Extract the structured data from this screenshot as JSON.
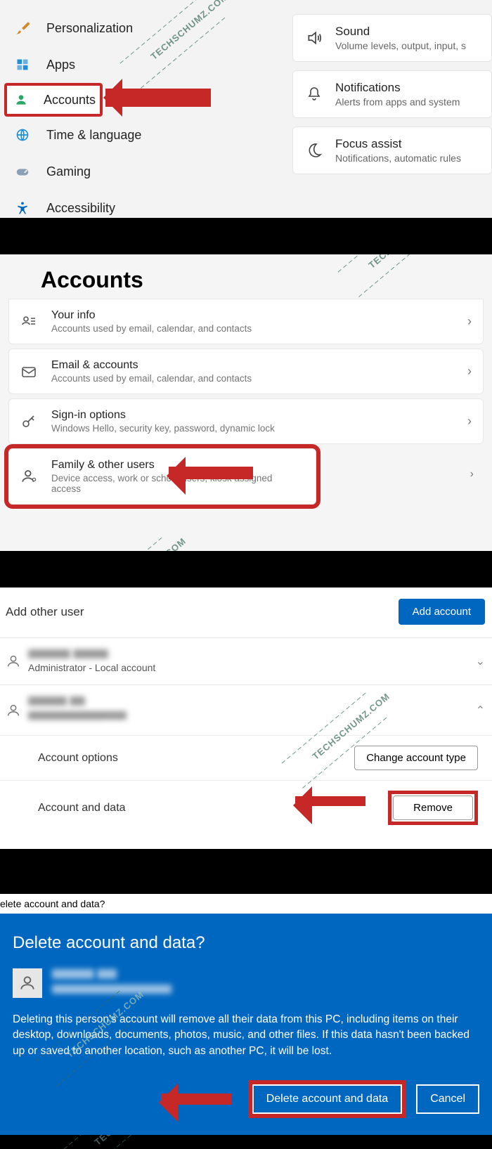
{
  "panel1": {
    "sidebar": [
      {
        "icon": "brush",
        "label": "Personalization",
        "color": "#d28a2b"
      },
      {
        "icon": "apps",
        "label": "Apps",
        "color": "#1f8fd6"
      },
      {
        "icon": "person",
        "label": "Accounts",
        "color": "#2aa866",
        "highlight": true
      },
      {
        "icon": "globe",
        "label": "Time & language",
        "color": "#1f8fd6"
      },
      {
        "icon": "game",
        "label": "Gaming",
        "color": "#8aa0b4"
      },
      {
        "icon": "access",
        "label": "Accessibility",
        "color": "#0067c0"
      }
    ],
    "cards": [
      {
        "icon": "sound",
        "title": "Sound",
        "sub": "Volume levels, output, input, s"
      },
      {
        "icon": "bell",
        "title": "Notifications",
        "sub": "Alerts from apps and system"
      },
      {
        "icon": "moon",
        "title": "Focus assist",
        "sub": "Notifications, automatic rules"
      }
    ]
  },
  "panel2": {
    "heading": "Accounts",
    "rows": [
      {
        "icon": "idcard",
        "title": "Your info",
        "sub": "Accounts used by email, calendar, and contacts"
      },
      {
        "icon": "mail",
        "title": "Email & accounts",
        "sub": "Accounts used by email, calendar, and contacts"
      },
      {
        "icon": "key",
        "title": "Sign-in options",
        "sub": "Windows Hello, security key, password, dynamic lock"
      },
      {
        "icon": "family",
        "title": "Family & other users",
        "sub": "Device access, work or school users, kiosk assigned access",
        "highlight": true
      }
    ]
  },
  "panel3": {
    "addOtherUser": "Add other user",
    "addAccountBtn": "Add account",
    "user1_sub": "Administrator - Local account",
    "accountOptions": "Account options",
    "changeType": "Change account type",
    "accountAndData": "Account and data",
    "removeBtn": "Remove"
  },
  "panel4": {
    "titlebar": "elete account and data?",
    "heading": "Delete account and data?",
    "message": "Deleting this person's account will remove all their data from this PC, including items on their desktop, downloads, documents, photos, music, and other files. If this data hasn't been backed up or saved to another location, such as another PC, it will be lost.",
    "deleteBtn": "Delete account and data",
    "cancelBtn": "Cancel"
  },
  "watermark": "TECHSCHUMZ.COM"
}
